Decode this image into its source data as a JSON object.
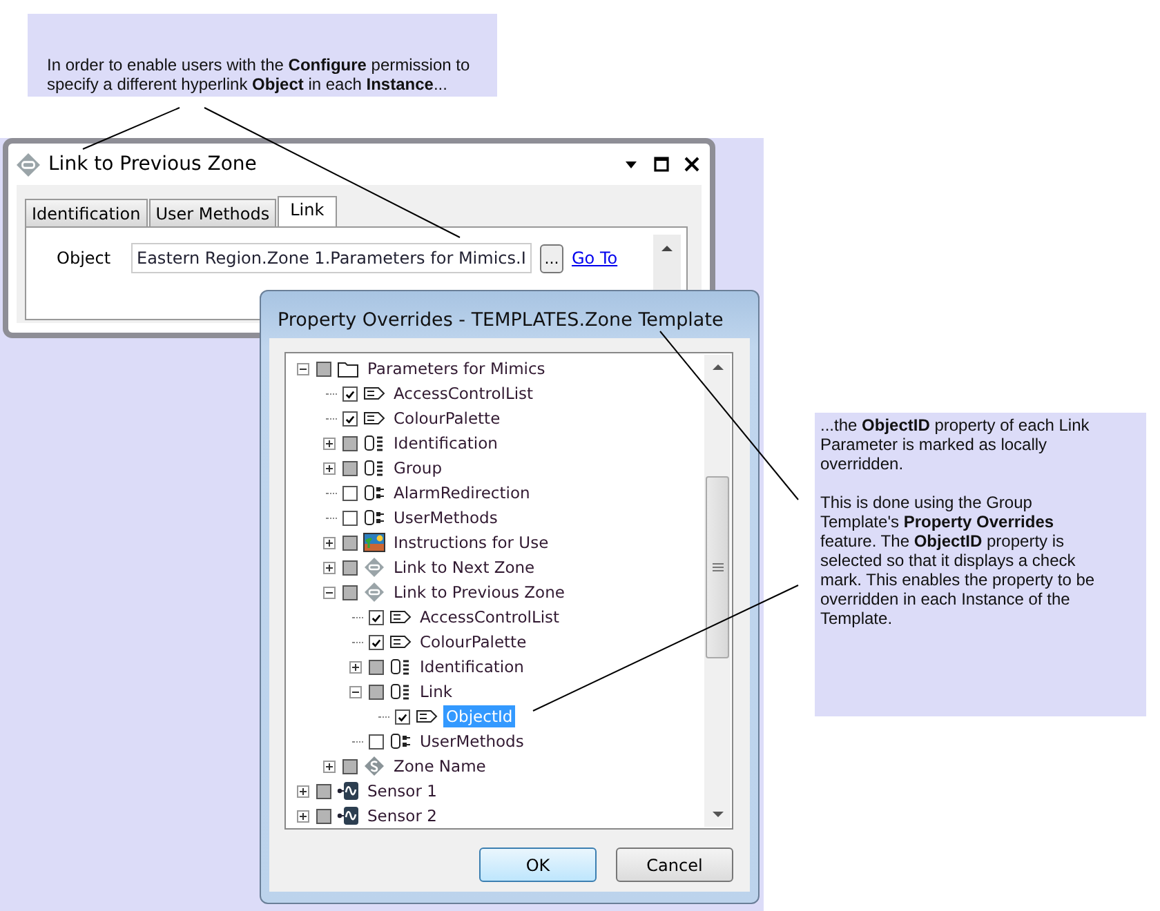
{
  "top_callout": {
    "text": "In order to enable users with the **Configure** permission to specify a different hyperlink **Object** in each **Instance**..."
  },
  "side_callout": {
    "paragraphs": [
      "...the **ObjectID** property of each Link Parameter is marked as locally overridden.",
      "This is done using the Group Template's **Property Overrides** feature. The **ObjectID** property is selected so that it displays a check mark. This enables the property to be overridden in each Instance of the Template."
    ]
  },
  "link_window": {
    "title": "Link to Previous Zone",
    "tabs": [
      {
        "label": "Identification",
        "selected": false
      },
      {
        "label": "User Methods",
        "selected": false
      },
      {
        "label": "Link",
        "selected": true
      }
    ],
    "field": {
      "label": "Object",
      "value": "Eastern Region.Zone 1.Parameters for Mimics.I"
    },
    "browse_button": "...",
    "link": "Go To"
  },
  "dialog": {
    "title": "Property Overrides - TEMPLATES.Zone Template",
    "tree": [
      {
        "label": "Parameters for Mimics",
        "checked": false,
        "indeterminate": true,
        "kind": "folder",
        "expanded": true,
        "selected": false,
        "children": [
          {
            "label": "AccessControlList",
            "checked": true,
            "indeterminate": false,
            "kind": "tag",
            "selected": false
          },
          {
            "label": "ColourPalette",
            "checked": true,
            "indeterminate": false,
            "kind": "tag",
            "selected": false
          },
          {
            "label": "Identification",
            "checked": false,
            "indeterminate": true,
            "kind": "list",
            "expanded": false,
            "selected": false
          },
          {
            "label": "Group",
            "checked": false,
            "indeterminate": true,
            "kind": "list",
            "expanded": false,
            "selected": false
          },
          {
            "label": "AlarmRedirection",
            "checked": false,
            "indeterminate": false,
            "kind": "methods",
            "selected": false
          },
          {
            "label": "UserMethods",
            "checked": false,
            "indeterminate": false,
            "kind": "methods",
            "selected": false
          },
          {
            "label": "Instructions for Use",
            "checked": false,
            "indeterminate": true,
            "kind": "picture",
            "expanded": false,
            "selected": false
          },
          {
            "label": "Link to Next Zone",
            "checked": false,
            "indeterminate": true,
            "kind": "link",
            "expanded": false,
            "selected": false
          },
          {
            "label": "Link to Previous Zone",
            "checked": false,
            "indeterminate": true,
            "kind": "link",
            "expanded": true,
            "selected": false,
            "children": [
              {
                "label": "AccessControlList",
                "checked": true,
                "indeterminate": false,
                "kind": "tag",
                "selected": false
              },
              {
                "label": "ColourPalette",
                "checked": true,
                "indeterminate": false,
                "kind": "tag",
                "selected": false
              },
              {
                "label": "Identification",
                "checked": false,
                "indeterminate": true,
                "kind": "list",
                "expanded": false,
                "selected": false
              },
              {
                "label": "Link",
                "checked": false,
                "indeterminate": true,
                "kind": "list",
                "expanded": true,
                "selected": false,
                "children": [
                  {
                    "label": "ObjectId",
                    "checked": true,
                    "indeterminate": false,
                    "kind": "tag",
                    "selected": true
                  }
                ]
              },
              {
                "label": "UserMethods",
                "checked": false,
                "indeterminate": false,
                "kind": "methods",
                "selected": false
              }
            ]
          },
          {
            "label": "Zone Name",
            "checked": false,
            "indeterminate": true,
            "kind": "string",
            "expanded": false,
            "selected": false
          }
        ]
      },
      {
        "label": "Sensor 1",
        "checked": false,
        "indeterminate": true,
        "kind": "sensor",
        "expanded": false,
        "selected": false
      },
      {
        "label": "Sensor 2",
        "checked": false,
        "indeterminate": true,
        "kind": "sensor",
        "expanded": false,
        "selected": false
      }
    ],
    "buttons": [
      {
        "label": "OK",
        "default": true
      },
      {
        "label": "Cancel",
        "default": false
      }
    ]
  }
}
